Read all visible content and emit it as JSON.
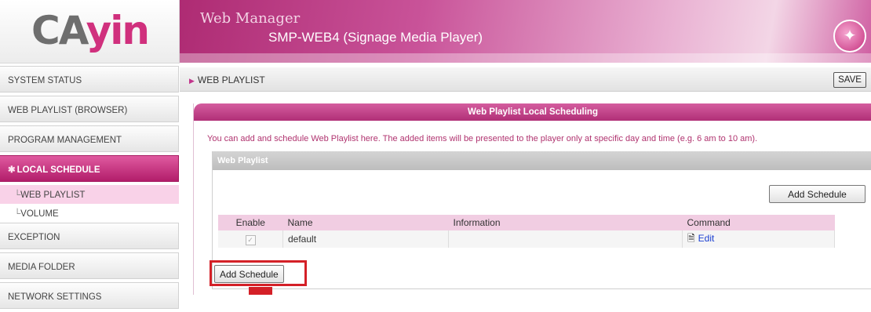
{
  "logo": {
    "part1": "CA",
    "part2": "yin"
  },
  "header": {
    "title": "Web Manager",
    "subtitle": "SMP-WEB4 (Signage Media Player)",
    "badge_icon": "magic-wand-icon"
  },
  "sidebar": {
    "items": [
      {
        "label": "SYSTEM STATUS"
      },
      {
        "label": "WEB PLAYLIST (BROWSER)"
      },
      {
        "label": "PROGRAM MANAGEMENT"
      },
      {
        "label": "LOCAL SCHEDULE",
        "active": true
      },
      {
        "label": "EXCEPTION"
      },
      {
        "label": "MEDIA FOLDER"
      },
      {
        "label": "NETWORK SETTINGS"
      }
    ],
    "subitems": [
      {
        "label": "WEB PLAYLIST",
        "active": true
      },
      {
        "label": "VOLUME"
      }
    ]
  },
  "breadcrumb": {
    "label": "WEB PLAYLIST",
    "save_label": "SAVE"
  },
  "panel": {
    "title": "Web Playlist Local Scheduling",
    "description": "You can add and schedule Web Playlist here. The added items will be presented to the player only at specific day and time (e.g. 6 am to 10 am).",
    "subpanel_title": "Web Playlist",
    "add_schedule_label": "Add Schedule"
  },
  "table": {
    "columns": [
      "Enable",
      "Name",
      "Information",
      "Command"
    ],
    "rows": [
      {
        "enabled": true,
        "name": "default",
        "information": "",
        "command": "Edit"
      }
    ]
  },
  "colors": {
    "accent": "#c2358c",
    "highlight": "#d42027"
  }
}
